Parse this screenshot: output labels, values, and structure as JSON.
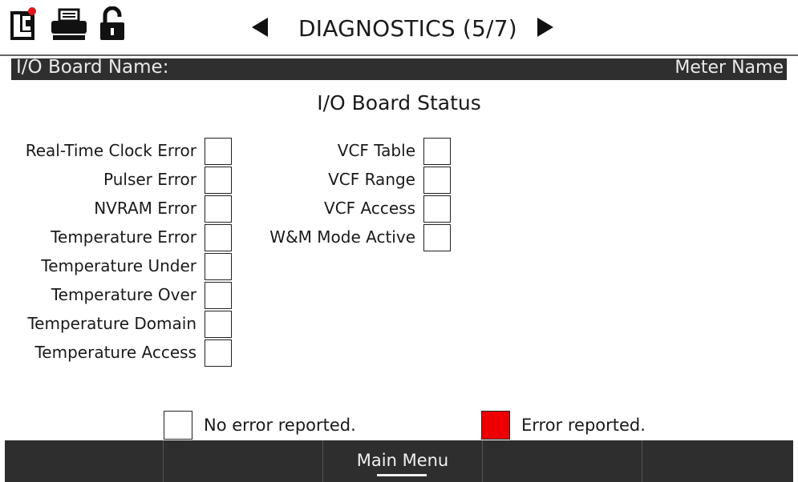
{
  "toolbar": {
    "icons": [
      "lc-logo-icon",
      "printer-icon",
      "unlock-icon"
    ],
    "title": "DIAGNOSTICS (5/7)"
  },
  "header": {
    "left": "I/O Board Name:",
    "right": "Meter Name"
  },
  "section_title": "I/O Board Status",
  "left_column": [
    {
      "label": "Real-Time Clock Error",
      "error": false
    },
    {
      "label": "Pulser Error",
      "error": false
    },
    {
      "label": "NVRAM Error",
      "error": false
    },
    {
      "label": "Temperature Error",
      "error": false
    },
    {
      "label": "Temperature Under",
      "error": false
    },
    {
      "label": "Temperature Over",
      "error": false
    },
    {
      "label": "Temperature Domain",
      "error": false
    },
    {
      "label": "Temperature Access",
      "error": false
    }
  ],
  "right_column": [
    {
      "label": "VCF Table",
      "error": false
    },
    {
      "label": "VCF Range",
      "error": false
    },
    {
      "label": "VCF Access",
      "error": false
    },
    {
      "label": "W&M Mode Active",
      "error": false
    }
  ],
  "legend": {
    "no_error": "No error reported.",
    "error": "Error reported."
  },
  "colors": {
    "error": "#ee0000",
    "no_error": "#ffffff",
    "bar": "#2e2e2e"
  },
  "bottom_bar": {
    "buttons": [
      "",
      "",
      "Main Menu",
      "",
      ""
    ]
  }
}
